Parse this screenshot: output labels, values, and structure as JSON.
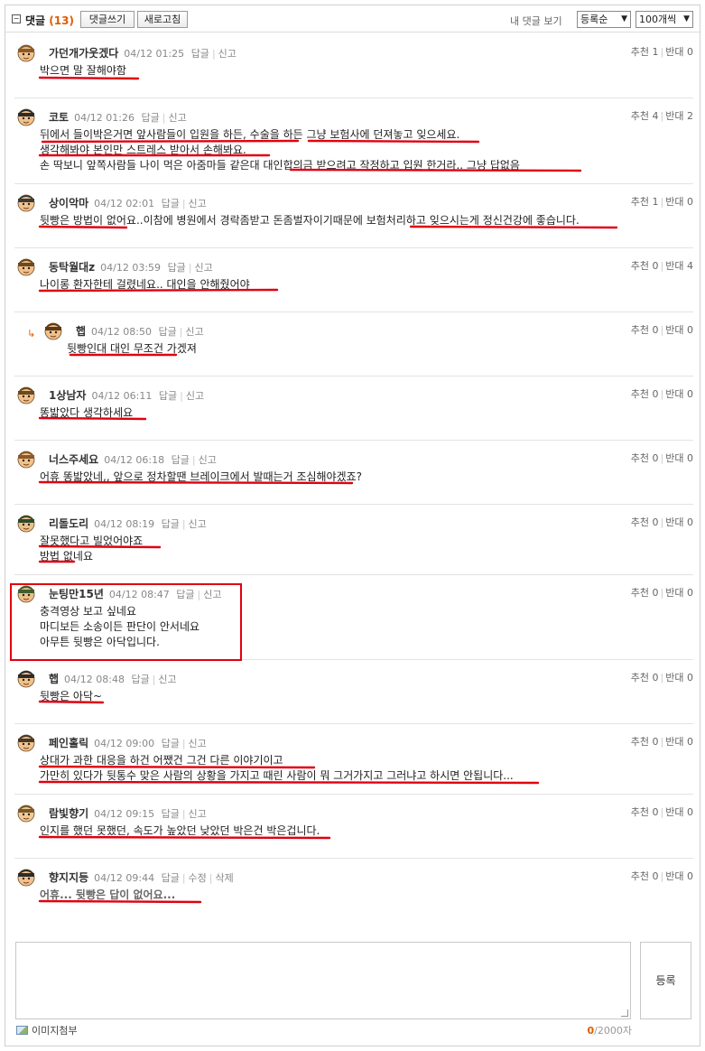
{
  "header": {
    "title": "댓글",
    "count": "(13)",
    "write_button": "댓글쓰기",
    "refresh_button": "새로고침",
    "my_comments": "내 댓글 보기",
    "sort_select": "등록순",
    "page_size_select": "100개씩"
  },
  "labels": {
    "reply": "답글",
    "report": "신고",
    "edit": "수정",
    "delete": "삭제",
    "up": "추천",
    "down": "반대"
  },
  "comments": [
    {
      "author": "가던개가웃겠다",
      "time": "04/12 01:25",
      "up": "1",
      "down": "0",
      "lines": [
        "박으면 말 잘해야함"
      ]
    },
    {
      "author": "코토",
      "time": "04/12 01:26",
      "up": "4",
      "down": "2",
      "lines": [
        "뒤에서 들이박은거면 앞사람들이 입원을 하든, 수술을 하든 그냥 보험사에 던져놓고 잊으세요.",
        "생각해봐야 본인만 스트레스 받아서 손해봐요.",
        "손 딱보니 앞쪽사람들 나이 먹은 아줌마들 같은대 대인합의금 받으려고 작정하고 입원 한거라.. 그냥 답없음"
      ]
    },
    {
      "author": "상이악마",
      "time": "04/12 02:01",
      "up": "1",
      "down": "0",
      "lines": [
        "뒷빵은 방법이 없어요..이참에 병원에서 경락좀받고 돈좀벌자이기때문에 보험처리하고 잊으시는게 정신건강에 좋습니다."
      ]
    },
    {
      "author": "동탁월대z",
      "time": "04/12 03:59",
      "up": "0",
      "down": "4",
      "lines": [
        "나이롱 환자한테 걸렸네요.. 대인을 안해줬어야"
      ]
    },
    {
      "author": "햅",
      "time": "04/12 08:50",
      "up": "0",
      "down": "0",
      "lines": [
        "뒷빵인대 대인 무조건 가겠져"
      ]
    },
    {
      "author": "1상남자",
      "time": "04/12 06:11",
      "up": "0",
      "down": "0",
      "lines": [
        "똥밟았다 생각하세요"
      ]
    },
    {
      "author": "너스주세요",
      "time": "04/12 06:18",
      "up": "0",
      "down": "0",
      "lines": [
        "어휴 똥밟았네,, 앞으로 정차할땐 브레이크에서 발때는거 조심해야겠죠?"
      ]
    },
    {
      "author": "리돌도리",
      "time": "04/12 08:19",
      "up": "0",
      "down": "0",
      "lines": [
        "잘못했다고 빌었어야죠",
        "방법 없네요"
      ]
    },
    {
      "author": "눈팅만15년",
      "time": "04/12 08:47",
      "up": "0",
      "down": "0",
      "lines": [
        "충격영상 보고 싶네요",
        "마디보든 소송이든 판단이 안서네요",
        "아무튼 뒷빵은 아닥입니다."
      ]
    },
    {
      "author": "햅",
      "time": "04/12 08:48",
      "up": "0",
      "down": "0",
      "lines": [
        "뒷빵은 아닥~"
      ]
    },
    {
      "author": "페인홀릭",
      "time": "04/12 09:00",
      "up": "0",
      "down": "0",
      "lines": [
        "상대가 과한 대응을 하건 어쨌건 그건 다른 이야기이고",
        "가만히 있다가 뒷통수 맞은 사람의 상황을 가지고 때린 사람이 뭐 그거가지고 그러냐고 하시면 안됩니다..."
      ]
    },
    {
      "author": "람빛향기",
      "time": "04/12 09:15",
      "up": "0",
      "down": "0",
      "lines": [
        "인지를 했던 못했던, 속도가 높았던 낮았던 박은건 박은겁니다."
      ]
    },
    {
      "author": "향지지등",
      "time": "04/12 09:44",
      "up": "0",
      "down": "0",
      "lines": [
        "어휴... 뒷빵은 답이 없어요..."
      ]
    }
  ],
  "editor": {
    "submit_label": "등록",
    "attach_label": "이미지첨부",
    "count_current": "0",
    "count_max": "/2000자"
  },
  "colors": {
    "accent": "#e05a00",
    "underline": "#e00010",
    "border": "#cfcfcf"
  }
}
